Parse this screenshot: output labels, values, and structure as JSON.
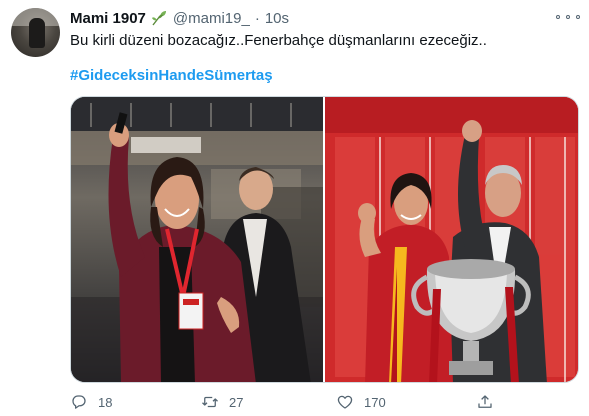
{
  "author": {
    "name": "Mami 1907",
    "handle": "@mami19_",
    "separator": "·",
    "time": "10s"
  },
  "tweet": {
    "text": "Bu kirli düzeni bozacağız..Fenerbahçe düşmanlarını ezeceğiz..",
    "hashtag": "#GideceksinHandeSümertaş"
  },
  "media": {
    "photo_count": 2
  },
  "actions": {
    "reply_count": "18",
    "retweet_count": "27",
    "like_count": "170"
  },
  "colors": {
    "accent": "#1d9bf0",
    "secondary_text": "#536471",
    "primary_text": "#0f1419",
    "media_border": "#cfd9de",
    "leaf_emoji": "#77b255"
  },
  "icons": [
    "avatar",
    "herb-emoji-icon",
    "more-options-icon",
    "reply-icon",
    "retweet-icon",
    "like-icon",
    "share-icon"
  ]
}
